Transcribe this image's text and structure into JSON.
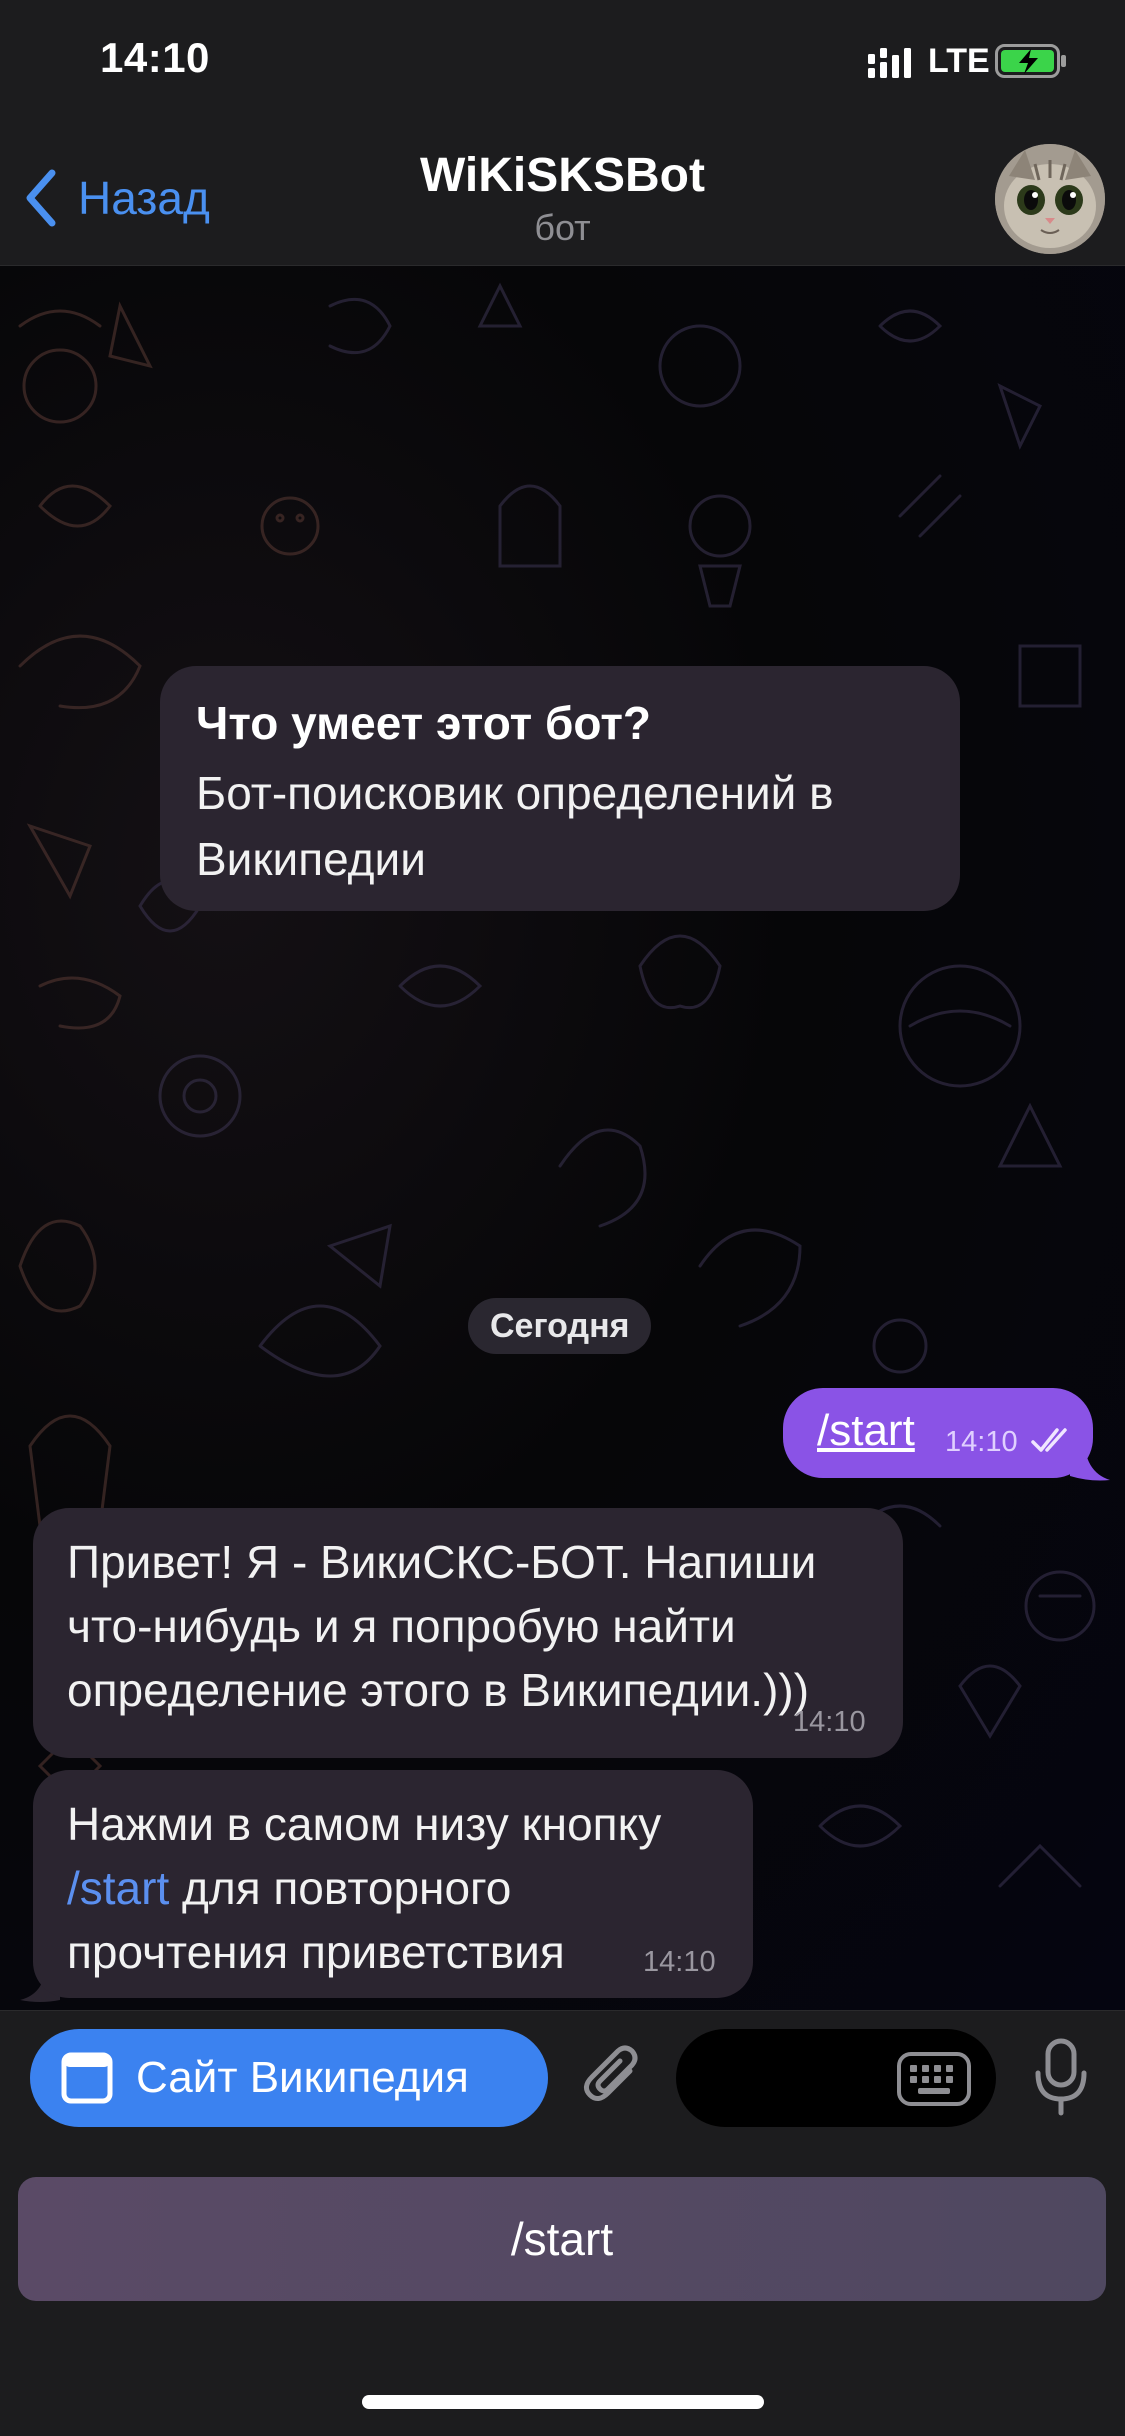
{
  "status_bar": {
    "time": "14:10",
    "network": "LTE"
  },
  "nav": {
    "back_label": "Назад",
    "title": "WiKiSKSBot",
    "subtitle": "бот"
  },
  "info_card": {
    "title": "Что умеет этот бот?",
    "text": "Бот-поисковик определений в Википедии"
  },
  "date_separator": "Сегодня",
  "messages": [
    {
      "direction": "out",
      "text": "/start",
      "time": "14:10",
      "status": "read"
    },
    {
      "direction": "in",
      "text": "Привет! Я - ВикиСКС-БОТ. Напиши что-нибудь и я попробую найти определение этого в Википедии.)))",
      "time": "14:10"
    },
    {
      "direction": "in",
      "text_before": "Нажми в самом низу кнопку ",
      "link": "/start",
      "text_after": " для повторного прочтения приветствия",
      "time": "14:10"
    }
  ],
  "input_bar": {
    "menu_button_label": "Сайт Википедия"
  },
  "keyboard": {
    "button_label": "/start"
  },
  "colors": {
    "accent": "#4a90f0",
    "outgoing_bubble": "#8a53e6",
    "incoming_bubble": "#2b2530",
    "menu_button": "#3b82f0"
  },
  "icons": [
    "chevron-left-icon",
    "app-window-icon",
    "paperclip-icon",
    "keyboard-icon",
    "microphone-icon",
    "double-check-icon",
    "battery-charging-icon",
    "signal-icon"
  ]
}
